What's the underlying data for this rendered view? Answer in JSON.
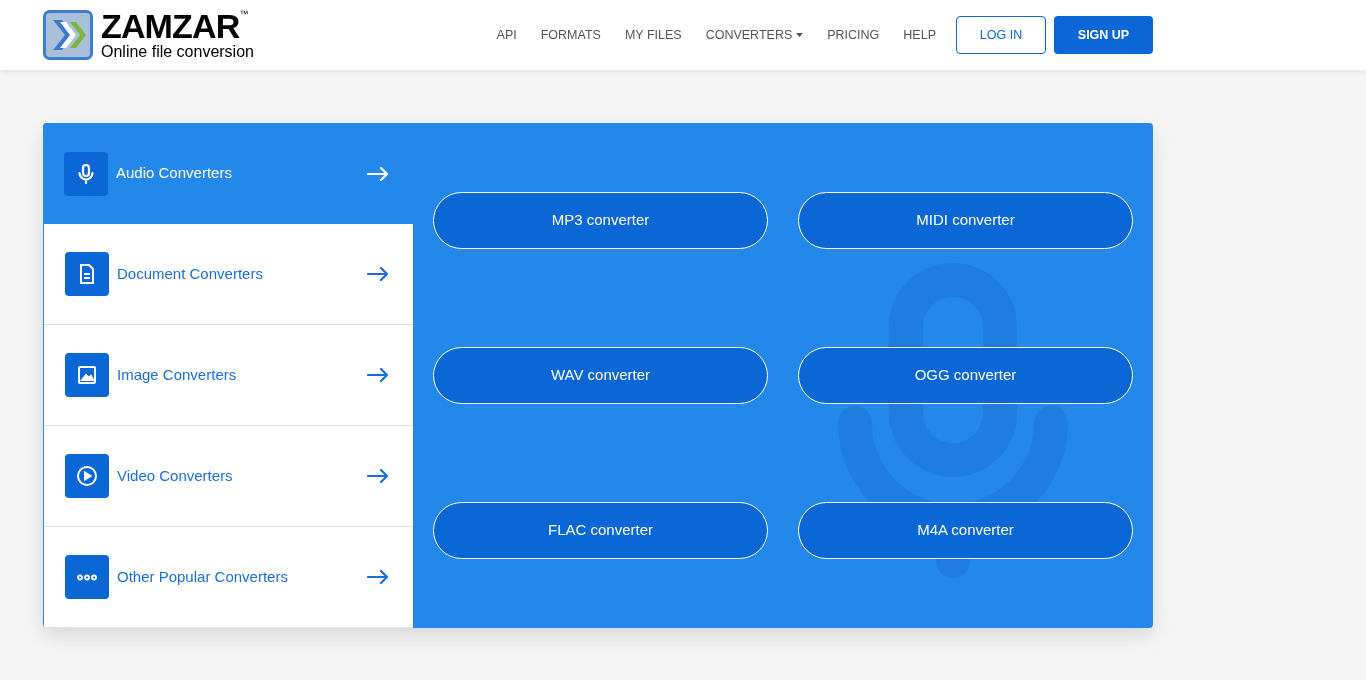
{
  "header": {
    "logo": {
      "name": "ZAMZAR",
      "mark": "™",
      "tagline": "Online file conversion"
    },
    "nav": [
      {
        "label": "API",
        "kind": "link"
      },
      {
        "label": "FORMATS",
        "kind": "link"
      },
      {
        "label": "MY FILES",
        "kind": "link"
      },
      {
        "label": "CONVERTERS",
        "kind": "dropdown"
      },
      {
        "label": "PRICING",
        "kind": "link"
      },
      {
        "label": "HELP",
        "kind": "link"
      }
    ],
    "buttons": [
      {
        "label": "LOG IN",
        "kind": "outline"
      },
      {
        "label": "SIGN UP",
        "kind": "filled"
      }
    ]
  },
  "categories": [
    {
      "label": "Audio Converters",
      "kind": "audio",
      "selected": true
    },
    {
      "label": "Document Converters",
      "kind": "document",
      "selected": false
    },
    {
      "label": "Image Converters",
      "kind": "image",
      "selected": false
    },
    {
      "label": "Video Converters",
      "kind": "video",
      "selected": false
    },
    {
      "label": "Other Popular Converters",
      "kind": "other",
      "selected": false
    }
  ],
  "converters": [
    "MP3 converter",
    "MIDI converter",
    "WAV converter",
    "OGG converter",
    "FLAC converter",
    "M4A converter"
  ]
}
